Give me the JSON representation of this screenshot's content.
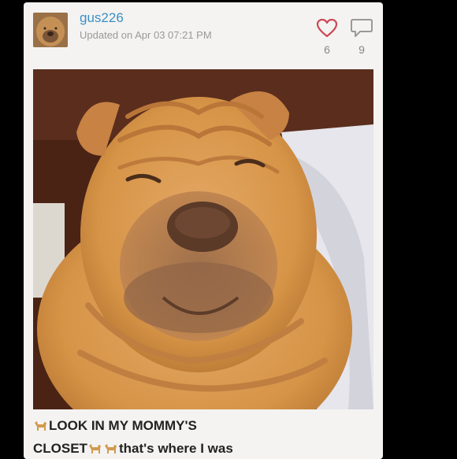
{
  "post": {
    "username": "gus226",
    "updated": "Updated on Apr 03 07:21 PM",
    "likes": "6",
    "comments": "9",
    "caption_part1": "LOOK IN MY MOMMY'S",
    "caption_part2": "CLOSET",
    "caption_part3": "that's where I was"
  },
  "icons": {
    "like": "heart-icon",
    "comment": "speech-bubble-icon",
    "emoji": "dog-emoji"
  },
  "colors": {
    "username": "#3a8fc7",
    "heart": "#c94a57",
    "card_bg": "#f4f3f1"
  }
}
